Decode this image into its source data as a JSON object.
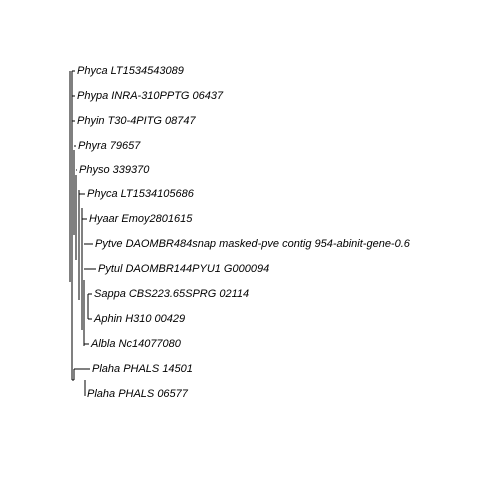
{
  "tree": {
    "line_color": "#000000",
    "text_color": "#000000",
    "background": "#ffffff",
    "leaves": [
      "Phyca LT1534543089",
      "Phypa INRA-310PPTG 06437",
      "Phyin T30-4PITG 08747",
      "Phyra 79657",
      "Physo 339370",
      "Phyca LT1534105686",
      "Hyaar Emoy2801615",
      "Pytve DAOMBR484snap masked-pve contig 954-abinit-gene-0.6",
      "Pytul DAOMBR144PYU1 G000094",
      "Sappa CBS223.65SPRG 02114",
      "Aphin H310 00429",
      "Albla Nc14077080",
      "Plaha PHALS 14501",
      "Plaha PHALS 06577"
    ]
  }
}
